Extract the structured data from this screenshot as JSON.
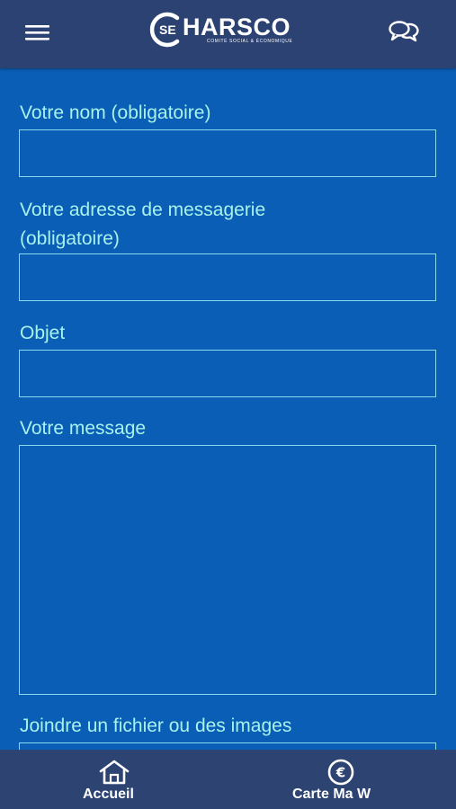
{
  "header": {
    "menu_icon": "hamburger-menu-icon",
    "logo": {
      "mark": "SE",
      "name": "HARSCO",
      "subtitle": "COMITÉ SOCIAL & ÉCONOMIQUE"
    },
    "chat_icon": "chat-bubbles-icon"
  },
  "form": {
    "name_label": "Votre nom (obligatoire)",
    "name_value": "",
    "email_label_line1": "Votre adresse de messagerie",
    "email_label_line2": "(obligatoire)",
    "email_value": "",
    "subject_label": "Objet",
    "subject_value": "",
    "message_label": "Votre message",
    "message_value": "",
    "attach_label": "Joindre un fichier ou des images"
  },
  "bottom_nav": {
    "items": [
      {
        "label": "Accueil",
        "icon": "home-icon"
      },
      {
        "label": "Carte Ma W",
        "icon": "euro-coin-icon"
      }
    ]
  },
  "colors": {
    "header_bg": "#2c4272",
    "form_bg": "#0a5eb6",
    "label_color": "#a8f2ec",
    "field_border": "#88d9ea",
    "nav_bg": "#2d4473"
  }
}
